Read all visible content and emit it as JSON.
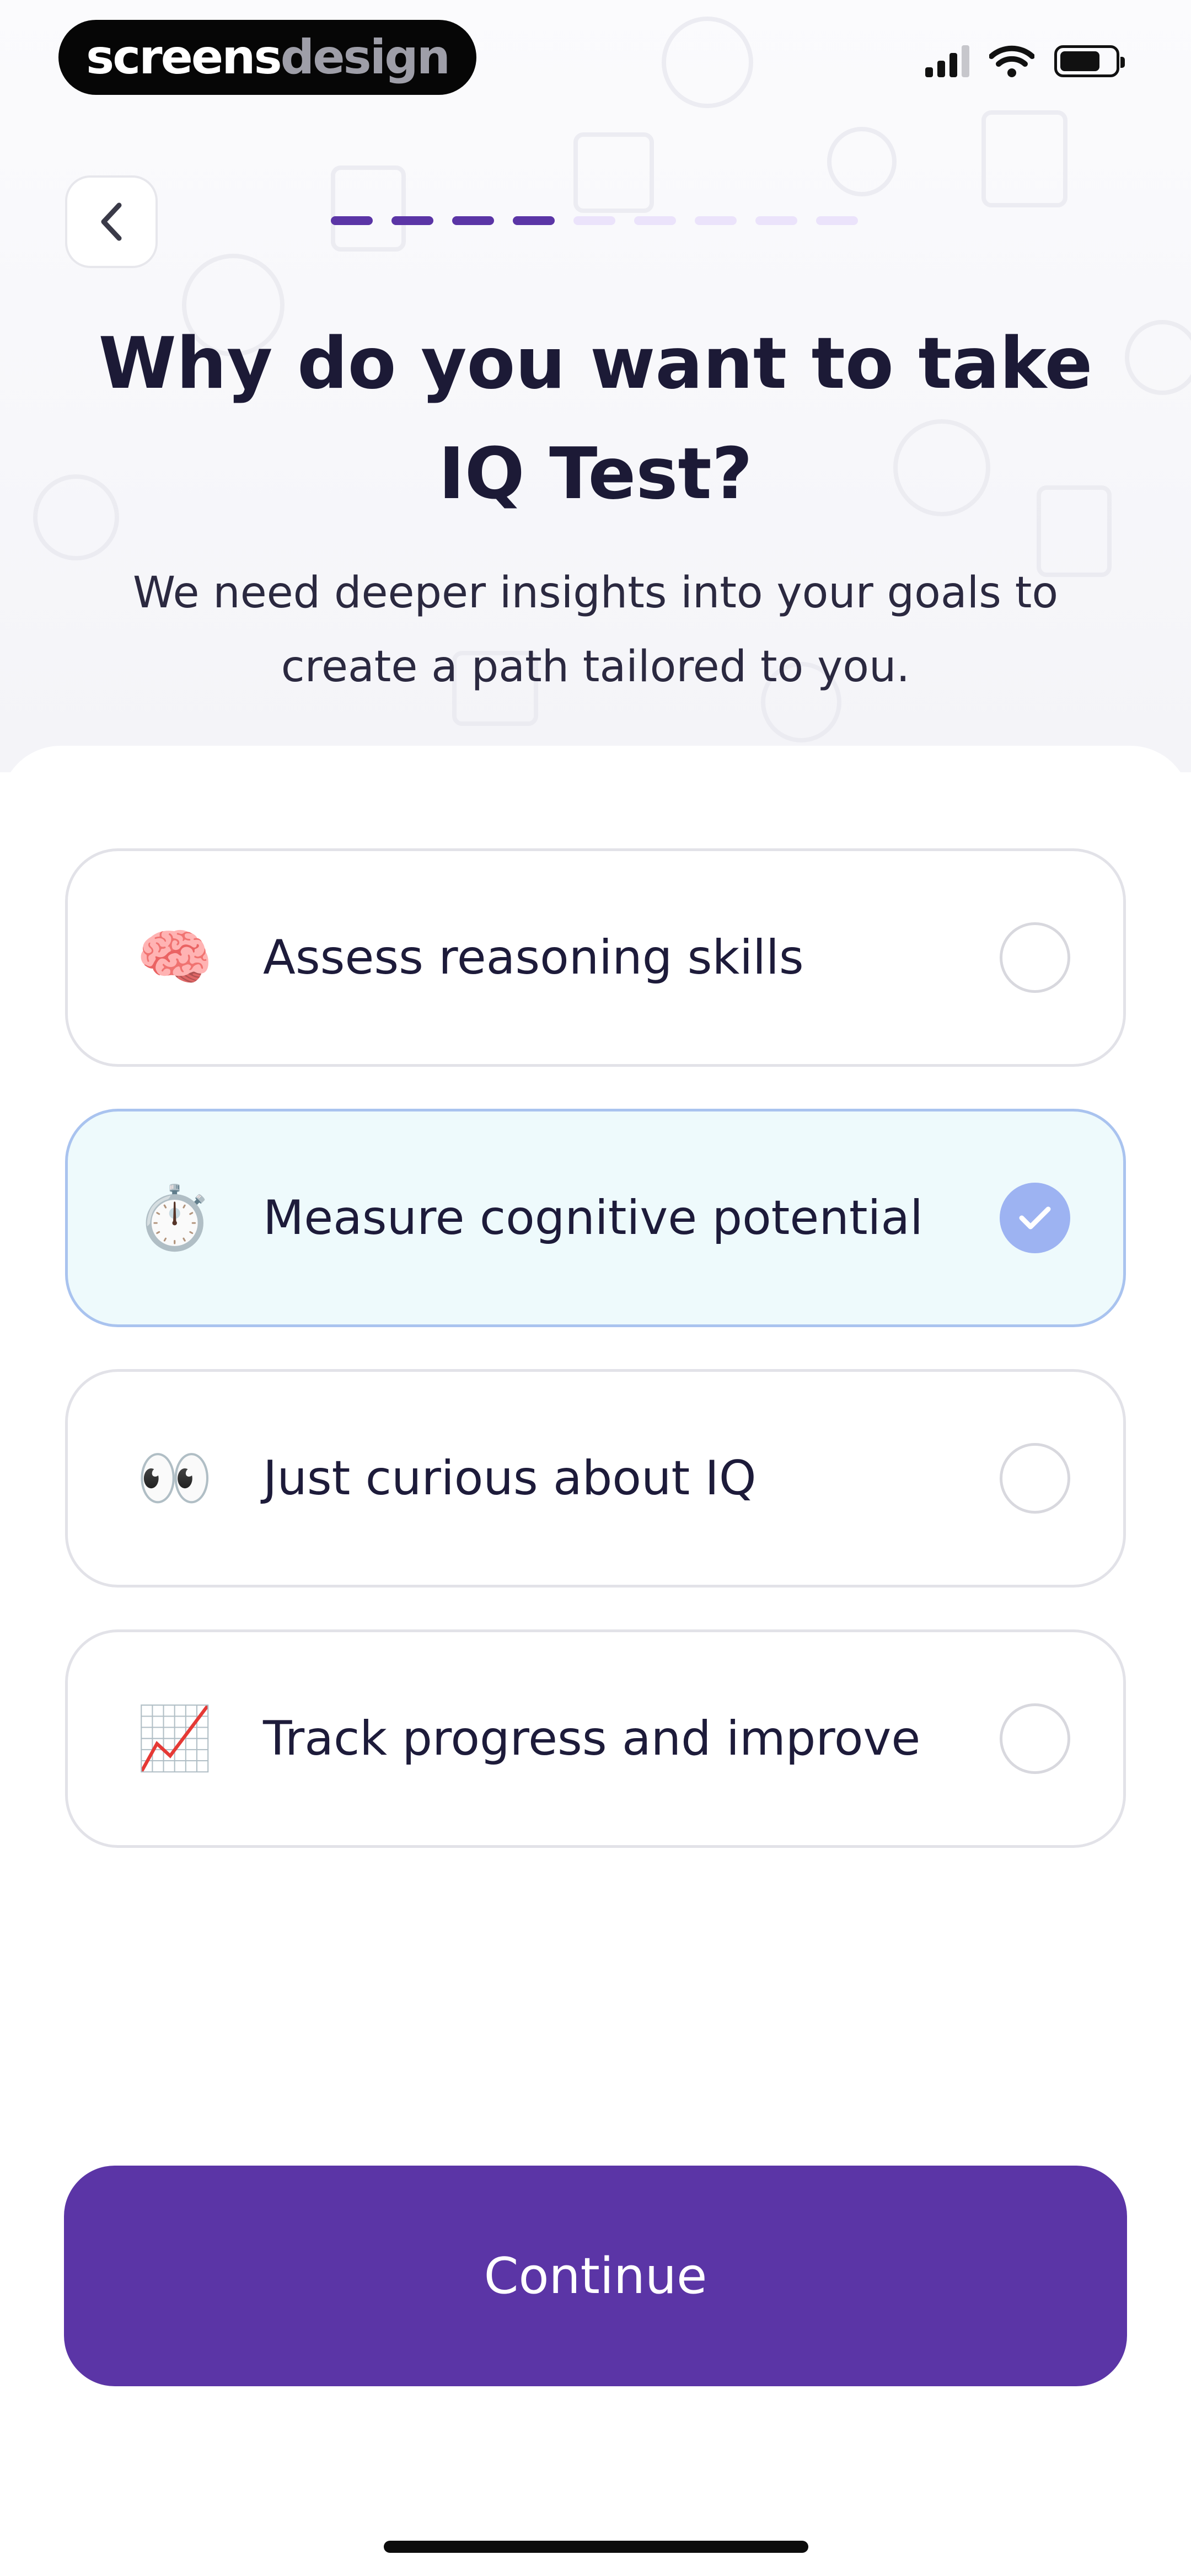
{
  "status_bar": {
    "brand_white": "screens",
    "brand_gray": "design"
  },
  "progress": {
    "current_step": 4,
    "total_steps": 9
  },
  "header": {
    "title": "Why do you want to take IQ Test?",
    "subtitle": "We need deeper insights into your goals to create a path tailored to you."
  },
  "options": [
    {
      "icon": "brain-icon",
      "emoji": "🧠",
      "label": "Assess reasoning skills",
      "selected": false
    },
    {
      "icon": "stopwatch-icon",
      "emoji": "⏱️",
      "label": "Measure cognitive potential",
      "selected": true
    },
    {
      "icon": "eyes-icon",
      "emoji": "👀",
      "label": "Just curious about IQ",
      "selected": false
    },
    {
      "icon": "chart-increasing-icon",
      "emoji": "📈",
      "label": "Track progress and improve",
      "selected": false
    }
  ],
  "footer": {
    "continue_label": "Continue"
  },
  "colors": {
    "accent": "#5b35a6",
    "progress_inactive": "#ebe3fb",
    "selected_bg": "#eefafc",
    "selected_border": "#a9c3ef",
    "check_fill": "#9db3f2"
  }
}
